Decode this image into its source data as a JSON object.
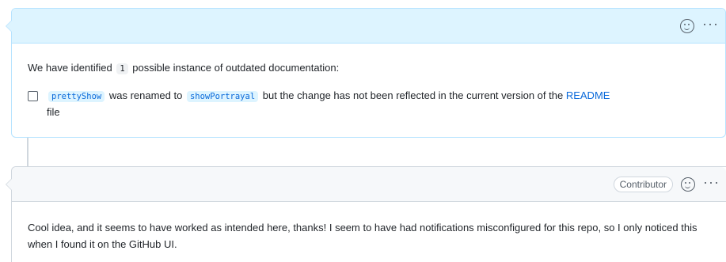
{
  "comment1": {
    "intro_before": "We have identified",
    "count": "1",
    "intro_after": "possible instance of outdated documentation:",
    "task": {
      "old_name": "prettyShow",
      "renamed_text": "was renamed to",
      "new_name": "showPortrayal",
      "rest_text": "but the change has not been reflected in the current version of the",
      "link_text": "README",
      "end_text": "file"
    }
  },
  "comment2": {
    "badge": "Contributor",
    "body": "Cool idea, and it seems to have worked as intended here, thanks! I seem to have had notifications misconfigured for this repo, so I only noticed this when I found it on the GitHub UI."
  },
  "icons": {
    "kebab": "···"
  }
}
